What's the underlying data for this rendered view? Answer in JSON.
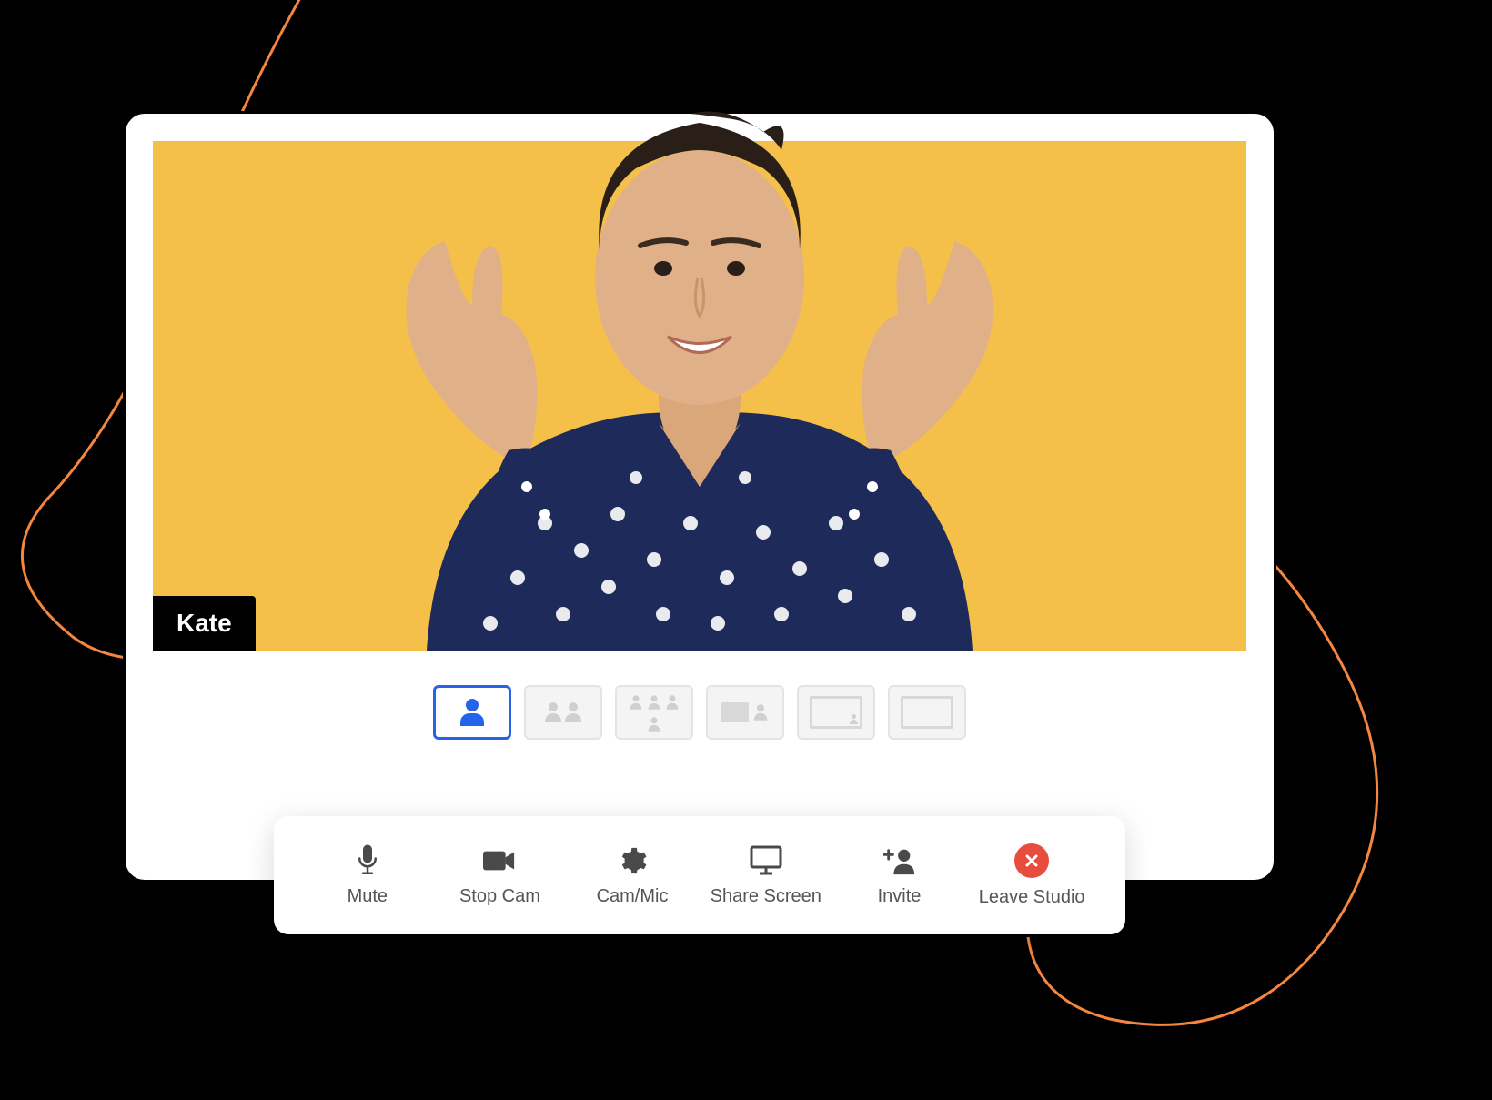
{
  "participant": {
    "name": "Kate"
  },
  "layouts": {
    "options": [
      "single",
      "two-up",
      "four-up",
      "screen-speaker",
      "screen-only",
      "full-screen"
    ],
    "active_index": 0
  },
  "controls": {
    "mute": "Mute",
    "stopcam": "Stop Cam",
    "cammic": "Cam/Mic",
    "sharescreen": "Share Screen",
    "invite": "Invite",
    "leave": "Leave Studio"
  },
  "colors": {
    "video_bg": "#f5c04a",
    "accent": "#2563eb",
    "leave": "#e74c3c",
    "swoosh": "#f5863f"
  }
}
